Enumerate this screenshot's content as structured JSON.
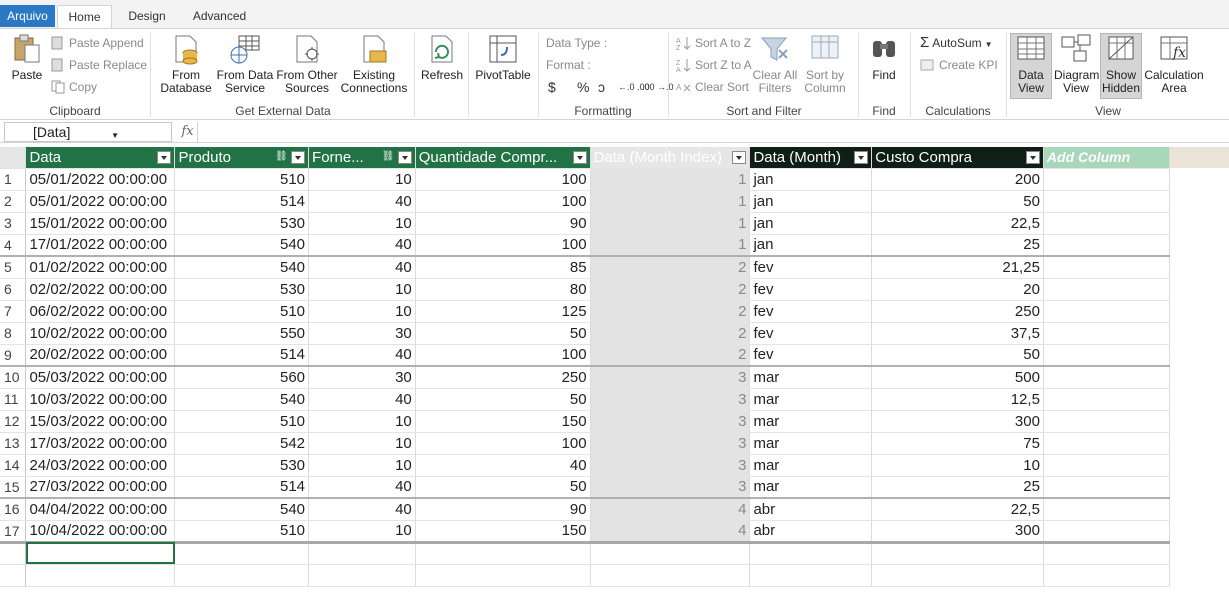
{
  "tabs": {
    "file": "Arquivo",
    "home": "Home",
    "design": "Design",
    "advanced": "Advanced"
  },
  "ribbon": {
    "clipboard": {
      "paste": "Paste",
      "paste_append": "Paste Append",
      "paste_replace": "Paste Replace",
      "copy": "Copy",
      "label": "Clipboard"
    },
    "external": {
      "from_database_1": "From",
      "from_database_2": "Database",
      "from_data_service_1": "From Data",
      "from_data_service_2": "Service",
      "from_other_1": "From Other",
      "from_other_2": "Sources",
      "existing_1": "Existing",
      "existing_2": "Connections",
      "label": "Get External Data"
    },
    "refresh": "Refresh",
    "pivottable": "PivotTable",
    "formatting": {
      "data_type": "Data Type :",
      "format": "Format :",
      "currency": "$",
      "percent": "%",
      "comma": "ɔ",
      "inc_dec": "←.0 .00",
      "dec_dec": ".00 →.0",
      "label": "Formatting"
    },
    "sort": {
      "sort_az": "Sort A to Z",
      "sort_za": "Sort Z to A",
      "clear_sort": "Clear Sort",
      "clear_filters_1": "Clear All",
      "clear_filters_2": "Filters",
      "sort_by_col_1": "Sort by",
      "sort_by_col_2": "Column",
      "label": "Sort and Filter"
    },
    "find": {
      "find": "Find",
      "label": "Find"
    },
    "calculations": {
      "autosum": "AutoSum",
      "create_kpi": "Create KPI",
      "label": "Calculations"
    },
    "view": {
      "data_view_1": "Data",
      "data_view_2": "View",
      "diagram_view_1": "Diagram",
      "diagram_view_2": "View",
      "show_hidden_1": "Show",
      "show_hidden_2": "Hidden",
      "calc_area_1": "Calculation",
      "calc_area_2": "Area",
      "label": "View"
    }
  },
  "formula_bar": {
    "name_box": "[Data]",
    "fx": "fx",
    "formula": ""
  },
  "grid": {
    "columns": [
      "Data",
      "Produto",
      "Forne...",
      "Quantidade Compr...",
      "Data (Month Index)",
      "Data (Month)",
      "Custo Compra",
      "Add Column"
    ],
    "rows": [
      [
        "1",
        "05/01/2022 00:00:00",
        "510",
        "10",
        "100",
        "1",
        "jan",
        "200"
      ],
      [
        "2",
        "05/01/2022 00:00:00",
        "514",
        "40",
        "100",
        "1",
        "jan",
        "50"
      ],
      [
        "3",
        "15/01/2022 00:00:00",
        "530",
        "10",
        "90",
        "1",
        "jan",
        "22,5"
      ],
      [
        "4",
        "17/01/2022 00:00:00",
        "540",
        "40",
        "100",
        "1",
        "jan",
        "25"
      ],
      [
        "5",
        "01/02/2022 00:00:00",
        "540",
        "40",
        "85",
        "2",
        "fev",
        "21,25"
      ],
      [
        "6",
        "02/02/2022 00:00:00",
        "530",
        "10",
        "80",
        "2",
        "fev",
        "20"
      ],
      [
        "7",
        "06/02/2022 00:00:00",
        "510",
        "10",
        "125",
        "2",
        "fev",
        "250"
      ],
      [
        "8",
        "10/02/2022 00:00:00",
        "550",
        "30",
        "50",
        "2",
        "fev",
        "37,5"
      ],
      [
        "9",
        "20/02/2022 00:00:00",
        "514",
        "40",
        "100",
        "2",
        "fev",
        "50"
      ],
      [
        "10",
        "05/03/2022 00:00:00",
        "560",
        "30",
        "250",
        "3",
        "mar",
        "500"
      ],
      [
        "11",
        "10/03/2022 00:00:00",
        "540",
        "40",
        "50",
        "3",
        "mar",
        "12,5"
      ],
      [
        "12",
        "15/03/2022 00:00:00",
        "510",
        "10",
        "150",
        "3",
        "mar",
        "300"
      ],
      [
        "13",
        "17/03/2022 00:00:00",
        "542",
        "10",
        "100",
        "3",
        "mar",
        "75"
      ],
      [
        "14",
        "24/03/2022 00:00:00",
        "530",
        "10",
        "40",
        "3",
        "mar",
        "10"
      ],
      [
        "15",
        "27/03/2022 00:00:00",
        "514",
        "40",
        "50",
        "3",
        "mar",
        "25"
      ],
      [
        "16",
        "04/04/2022 00:00:00",
        "540",
        "40",
        "90",
        "4",
        "abr",
        "22,5"
      ],
      [
        "17",
        "10/04/2022 00:00:00",
        "510",
        "10",
        "150",
        "4",
        "abr",
        "300"
      ]
    ]
  },
  "colors": {
    "header_green": "#217346",
    "accent_blue": "#2b78c5",
    "add_column": "#a9d7b9",
    "index_gray": "#e3e3e3"
  }
}
